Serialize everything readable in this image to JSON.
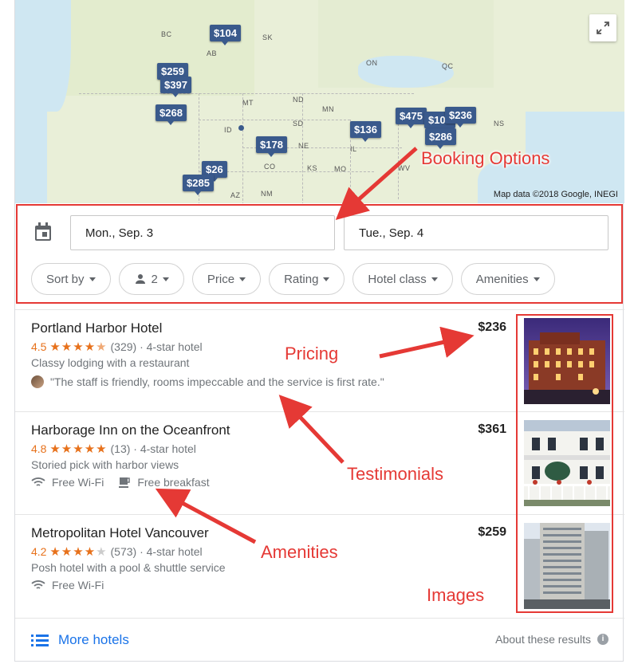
{
  "map": {
    "attribution": "Map data ©2018 Google, INEGI",
    "regions": [
      "BC",
      "SK",
      "AB",
      "ON",
      "QC",
      "MT",
      "ND",
      "MN",
      "SD",
      "ID",
      "NE",
      "CO",
      "KS",
      "MO",
      "IL",
      "NM",
      "AZ",
      "NS",
      "WV"
    ],
    "pins": [
      "$104",
      "$259",
      "$397",
      "$268",
      "$178",
      "$26",
      "$285",
      "$136",
      "$475",
      "$104",
      "$236",
      "$286"
    ]
  },
  "booking": {
    "checkin": "Mon., Sep. 3",
    "checkout": "Tue., Sep. 4",
    "filters": [
      "Sort by",
      "2",
      "Price",
      "Rating",
      "Hotel class",
      "Amenities"
    ]
  },
  "hotels": [
    {
      "name": "Portland Harbor Hotel",
      "rating": "4.5",
      "stars": "★★★★",
      "star_half": "★",
      "stars_empty": "",
      "meta": "(329) · 4-star hotel",
      "desc": "Classy lodging with a restaurant",
      "quote": "\"The staff is friendly, rooms impeccable and the service is first rate.\"",
      "price": "$236"
    },
    {
      "name": "Harborage Inn on the Oceanfront",
      "rating": "4.8",
      "stars": "★★★★★",
      "star_half": "",
      "stars_empty": "",
      "meta": "(13) · 4-star hotel",
      "desc": "Storied pick with harbor views",
      "amenity1": "Free Wi-Fi",
      "amenity2": "Free breakfast",
      "price": "$361"
    },
    {
      "name": "Metropolitan Hotel Vancouver",
      "rating": "4.2",
      "stars": "★★★★",
      "star_half": "",
      "stars_empty": "★",
      "meta": "(573) · 4-star hotel",
      "desc": "Posh hotel with a pool & shuttle service",
      "amenity1": "Free Wi-Fi",
      "price": "$259"
    }
  ],
  "footer": {
    "more_hotels": "More hotels",
    "about": "About these results"
  },
  "annotations": {
    "booking_options": "Booking Options",
    "pricing": "Pricing",
    "testimonials": "Testimonials",
    "amenities": "Amenities",
    "images": "Images",
    "color": "#e53935"
  }
}
